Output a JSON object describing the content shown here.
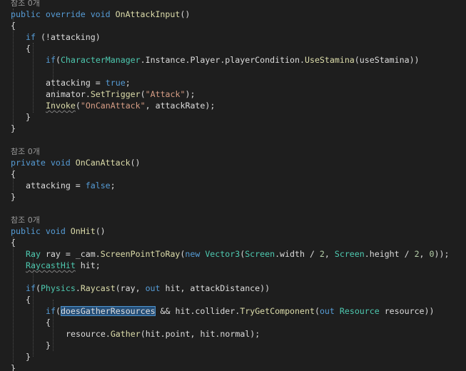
{
  "code_lines": [
    {
      "indent": 1,
      "segments": [
        [
          "lens",
          "참조 0개"
        ]
      ]
    },
    {
      "indent": 1,
      "segments": [
        [
          "kw",
          "public"
        ],
        [
          "",
          " "
        ],
        [
          "kw",
          "override"
        ],
        [
          "",
          " "
        ],
        [
          "kw",
          "void"
        ],
        [
          "",
          " "
        ],
        [
          "fn",
          "OnAttackInput"
        ],
        [
          "",
          "()"
        ]
      ]
    },
    {
      "indent": 1,
      "segments": [
        [
          "",
          "{"
        ]
      ]
    },
    {
      "indent": 4,
      "segments": [
        [
          "kw",
          "if"
        ],
        [
          "",
          " (!attacking)"
        ]
      ]
    },
    {
      "indent": 4,
      "segments": [
        [
          "",
          "{"
        ]
      ]
    },
    {
      "indent": 8,
      "segments": [
        [
          "kw",
          "if"
        ],
        [
          "",
          "("
        ],
        [
          "ty",
          "CharacterManager"
        ],
        [
          "",
          ".Instance.Player.playerCondition."
        ],
        [
          "fn",
          "UseStamina"
        ],
        [
          "",
          "(useStamina))"
        ]
      ]
    },
    {
      "indent": 1,
      "segments": []
    },
    {
      "indent": 8,
      "segments": [
        [
          "",
          "attacking = "
        ],
        [
          "kw",
          "true"
        ],
        [
          "",
          ";"
        ]
      ]
    },
    {
      "indent": 8,
      "segments": [
        [
          "",
          "animator."
        ],
        [
          "fn",
          "SetTrigger"
        ],
        [
          "",
          "("
        ],
        [
          "str",
          "\"Attack\""
        ],
        [
          "",
          ");"
        ]
      ]
    },
    {
      "indent": 8,
      "segments": [
        [
          "fn squig",
          "Invoke"
        ],
        [
          "",
          "("
        ],
        [
          "str",
          "\"OnCanAttack\""
        ],
        [
          "",
          ", attackRate);"
        ]
      ]
    },
    {
      "indent": 4,
      "segments": [
        [
          "",
          "}"
        ]
      ]
    },
    {
      "indent": 1,
      "segments": [
        [
          "",
          "}"
        ]
      ]
    },
    {
      "indent": 1,
      "segments": []
    },
    {
      "indent": 1,
      "segments": [
        [
          "lens",
          "참조 0개"
        ]
      ]
    },
    {
      "indent": 1,
      "segments": [
        [
          "kw",
          "private"
        ],
        [
          "",
          " "
        ],
        [
          "kw",
          "void"
        ],
        [
          "",
          " "
        ],
        [
          "fn",
          "OnCanAttack"
        ],
        [
          "",
          "()"
        ]
      ]
    },
    {
      "indent": 1,
      "segments": [
        [
          "",
          "{"
        ]
      ]
    },
    {
      "indent": 4,
      "segments": [
        [
          "",
          "attacking = "
        ],
        [
          "kw",
          "false"
        ],
        [
          "",
          ";"
        ]
      ]
    },
    {
      "indent": 1,
      "segments": [
        [
          "",
          "}"
        ]
      ]
    },
    {
      "indent": 1,
      "segments": []
    },
    {
      "indent": 1,
      "segments": [
        [
          "lens",
          "참조 0개"
        ]
      ]
    },
    {
      "indent": 1,
      "segments": [
        [
          "kw",
          "public"
        ],
        [
          "",
          " "
        ],
        [
          "kw",
          "void"
        ],
        [
          "",
          " "
        ],
        [
          "fn",
          "OnHit"
        ],
        [
          "",
          "()"
        ]
      ]
    },
    {
      "indent": 1,
      "segments": [
        [
          "",
          "{"
        ]
      ]
    },
    {
      "indent": 4,
      "segments": [
        [
          "ty",
          "Ray"
        ],
        [
          "",
          " ray = _cam."
        ],
        [
          "fn",
          "ScreenPointToRay"
        ],
        [
          "",
          "("
        ],
        [
          "kw",
          "new"
        ],
        [
          "",
          " "
        ],
        [
          "ty",
          "Vector3"
        ],
        [
          "",
          "("
        ],
        [
          "ty",
          "Screen"
        ],
        [
          "",
          ".width / "
        ],
        [
          "num",
          "2"
        ],
        [
          "",
          ", "
        ],
        [
          "ty",
          "Screen"
        ],
        [
          "",
          ".height / "
        ],
        [
          "num",
          "2"
        ],
        [
          "",
          ", "
        ],
        [
          "num",
          "0"
        ],
        [
          "",
          "));"
        ]
      ]
    },
    {
      "indent": 4,
      "segments": [
        [
          "ty squig",
          "RaycastHit"
        ],
        [
          "",
          " hit;"
        ]
      ]
    },
    {
      "indent": 1,
      "segments": []
    },
    {
      "indent": 4,
      "segments": [
        [
          "kw",
          "if"
        ],
        [
          "",
          "("
        ],
        [
          "ty",
          "Physics"
        ],
        [
          "",
          "."
        ],
        [
          "fn",
          "Raycast"
        ],
        [
          "",
          "(ray, "
        ],
        [
          "kw",
          "out"
        ],
        [
          "",
          " hit, attackDistance))"
        ]
      ]
    },
    {
      "indent": 4,
      "segments": [
        [
          "",
          "{"
        ]
      ]
    },
    {
      "indent": 8,
      "segments": [
        [
          "kw",
          "if"
        ],
        [
          "",
          "("
        ],
        [
          "hl",
          "doesGatherResources"
        ],
        [
          "",
          " && hit.collider."
        ],
        [
          "fn",
          "TryGetComponent"
        ],
        [
          "",
          "("
        ],
        [
          "kw",
          "out"
        ],
        [
          "",
          " "
        ],
        [
          "ty",
          "Resource"
        ],
        [
          "",
          " resource))"
        ]
      ]
    },
    {
      "indent": 8,
      "segments": [
        [
          "",
          "{"
        ]
      ]
    },
    {
      "indent": 12,
      "segments": [
        [
          "",
          "resource."
        ],
        [
          "fn",
          "Gather"
        ],
        [
          "",
          "(hit.point, hit.normal);"
        ]
      ]
    },
    {
      "indent": 8,
      "segments": [
        [
          "",
          "}"
        ]
      ]
    },
    {
      "indent": 4,
      "segments": [
        [
          "",
          "}"
        ]
      ]
    },
    {
      "indent": 1,
      "segments": [
        [
          "",
          "}"
        ]
      ]
    }
  ]
}
